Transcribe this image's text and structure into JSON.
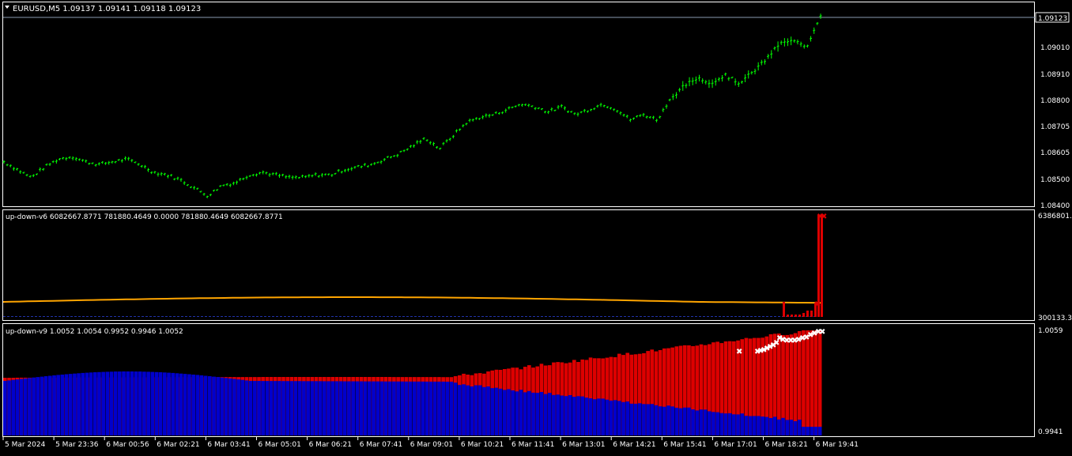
{
  "main_chart": {
    "symbol_line": "EURUSD,M5  1.09137 1.09141 1.09118 1.09123",
    "current_price_label": "1.09123",
    "y_ticks": [
      "1.09010",
      "1.08910",
      "1.08800",
      "1.08705",
      "1.08605",
      "1.08500",
      "1.08400"
    ]
  },
  "indicator1": {
    "label": "up-down-v6 6082667.8771 781880.4649 0.0000 781880.4649 6082667.8771",
    "y_top_label": "6386801.2",
    "y_bottom_label": "300133.3"
  },
  "indicator2": {
    "label": "up-down-v9 1.0052 1.0054 0.9952 0.9946 1.0052",
    "y_top_label": "1.0059",
    "y_bottom_label": "0.9941"
  },
  "time_axis": {
    "labels": [
      "5 Mar 2024",
      "5 Mar 23:36",
      "6 Mar 00:56",
      "6 Mar 02:21",
      "6 Mar 03:41",
      "6 Mar 05:01",
      "6 Mar 06:21",
      "6 Mar 07:41",
      "6 Mar 09:01",
      "6 Mar 10:21",
      "6 Mar 11:41",
      "6 Mar 13:01",
      "6 Mar 14:21",
      "6 Mar 15:41",
      "6 Mar 17:01",
      "6 Mar 18:21",
      "6 Mar 19:41"
    ]
  },
  "colors": {
    "candles": "#00ff00",
    "bull_red": "#dd0000",
    "bear_blue": "#0000cc",
    "ma_orange": "#ffa500",
    "marker_white": "#ffffff",
    "grid": "#ffffff"
  },
  "chart_data": {
    "type": "line",
    "title": "EURUSD,M5",
    "ylim": [
      1.084,
      1.09123
    ],
    "price_path": [
      1.0856,
      1.0853,
      1.085,
      1.0854,
      1.0857,
      1.0858,
      1.0856,
      1.0855,
      1.0856,
      1.0857,
      1.0855,
      1.0852,
      1.0851,
      1.0849,
      1.0846,
      1.0843,
      1.0847,
      1.0848,
      1.0851,
      1.0852,
      1.0851,
      1.085,
      1.085,
      1.0851,
      1.0851,
      1.0853,
      1.0854,
      1.0855,
      1.0857,
      1.0859,
      1.0862,
      1.0865,
      1.0861,
      1.0866,
      1.0871,
      1.0873,
      1.0874,
      1.0876,
      1.0878,
      1.0877,
      1.0875,
      1.0877,
      1.0874,
      1.0876,
      1.0878,
      1.0876,
      1.0872,
      1.0874,
      1.0872,
      1.088,
      1.0885,
      1.0888,
      1.0886,
      1.0889,
      1.0886,
      1.089,
      1.0895,
      1.0901,
      1.0902,
      1.09,
      1.0912
    ]
  }
}
